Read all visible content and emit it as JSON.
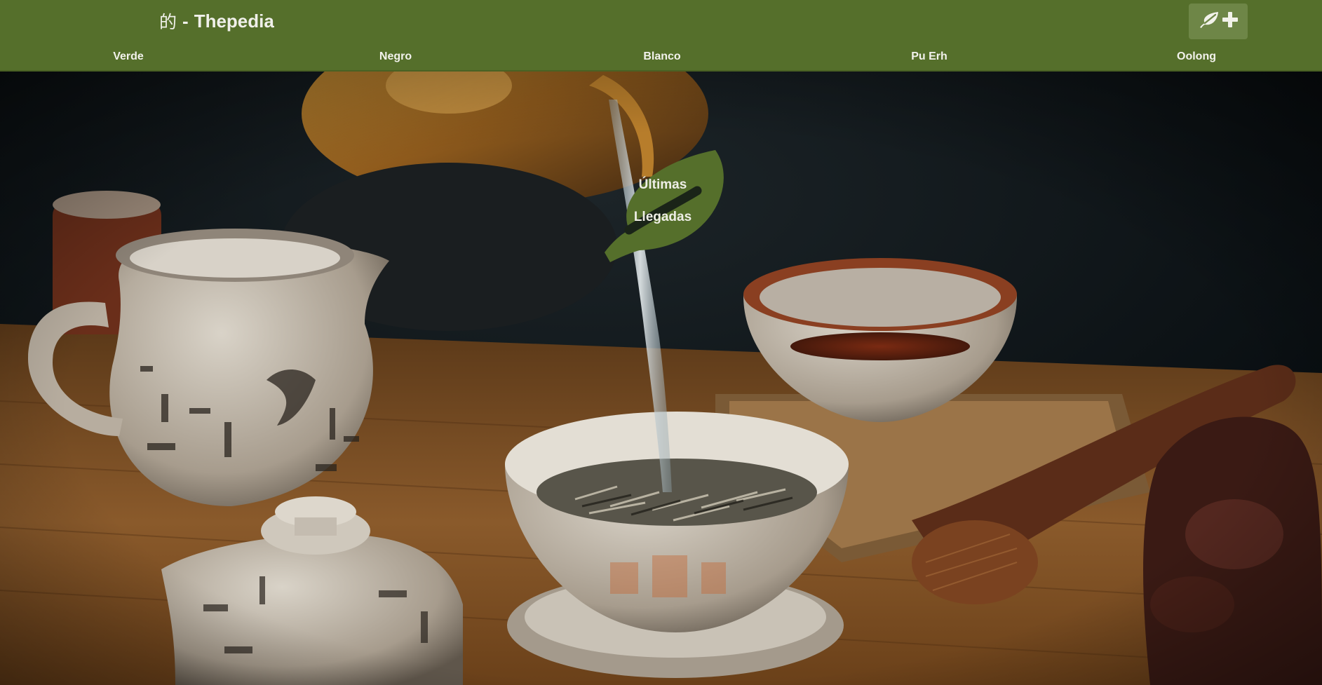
{
  "header": {
    "glyph": "的",
    "separator": "-",
    "title": "Thepedia",
    "background_color": "#556f2b",
    "add_button": {
      "icons": [
        "leaf-icon",
        "plus-icon"
      ],
      "background_color": "#6e8647"
    }
  },
  "nav": {
    "items": [
      {
        "label": "Verde"
      },
      {
        "label": "Negro"
      },
      {
        "label": "Blanco"
      },
      {
        "label": "Pu Erh"
      },
      {
        "label": "Oolong"
      }
    ]
  },
  "hero": {
    "image": "tea-ceremony-photo",
    "latest_arrivals": {
      "line1": "Últimas",
      "line2": "Llegadas",
      "icon": "leaf-icon",
      "color": "#556f2b"
    }
  }
}
